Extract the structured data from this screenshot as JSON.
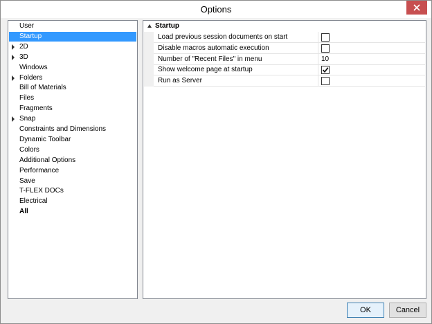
{
  "window": {
    "title": "Options"
  },
  "sidebar": {
    "items": [
      {
        "label": "User",
        "expandable": false,
        "selected": false,
        "bold": false
      },
      {
        "label": "Startup",
        "expandable": false,
        "selected": true,
        "bold": false
      },
      {
        "label": "2D",
        "expandable": true,
        "selected": false,
        "bold": false
      },
      {
        "label": "3D",
        "expandable": true,
        "selected": false,
        "bold": false
      },
      {
        "label": "Windows",
        "expandable": false,
        "selected": false,
        "bold": false
      },
      {
        "label": "Folders",
        "expandable": true,
        "selected": false,
        "bold": false
      },
      {
        "label": "Bill of Materials",
        "expandable": false,
        "selected": false,
        "bold": false
      },
      {
        "label": "Files",
        "expandable": false,
        "selected": false,
        "bold": false
      },
      {
        "label": "Fragments",
        "expandable": false,
        "selected": false,
        "bold": false
      },
      {
        "label": "Snap",
        "expandable": true,
        "selected": false,
        "bold": false
      },
      {
        "label": "Constraints and Dimensions",
        "expandable": false,
        "selected": false,
        "bold": false
      },
      {
        "label": "Dynamic Toolbar",
        "expandable": false,
        "selected": false,
        "bold": false
      },
      {
        "label": "Colors",
        "expandable": false,
        "selected": false,
        "bold": false
      },
      {
        "label": "Additional Options",
        "expandable": false,
        "selected": false,
        "bold": false
      },
      {
        "label": "Performance",
        "expandable": false,
        "selected": false,
        "bold": false
      },
      {
        "label": "Save",
        "expandable": false,
        "selected": false,
        "bold": false
      },
      {
        "label": "T-FLEX DOCs",
        "expandable": false,
        "selected": false,
        "bold": false
      },
      {
        "label": "Electrical",
        "expandable": false,
        "selected": false,
        "bold": false
      },
      {
        "label": "All",
        "expandable": false,
        "selected": false,
        "bold": true
      }
    ]
  },
  "main": {
    "group_title": "Startup",
    "properties": [
      {
        "name": "Load previous session documents on start",
        "type": "checkbox",
        "checked": false
      },
      {
        "name": "Disable macros automatic execution",
        "type": "checkbox",
        "checked": false
      },
      {
        "name": "Number of \"Recent Files\" in menu",
        "type": "number",
        "value": "10"
      },
      {
        "name": "Show welcome page at startup",
        "type": "checkbox",
        "checked": true
      },
      {
        "name": "Run as Server",
        "type": "checkbox",
        "checked": false
      }
    ]
  },
  "buttons": {
    "ok": "OK",
    "cancel": "Cancel"
  },
  "colors": {
    "selection": "#3399ff",
    "close": "#c74f50"
  }
}
